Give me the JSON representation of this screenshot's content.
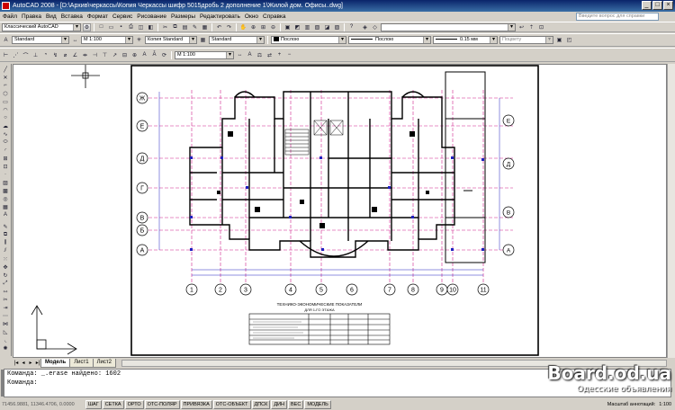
{
  "window": {
    "title": "AutoCAD 2008 - [D:\\Архив\\черкассы\\Копия Черкассы шифр  5015дробь 2 дополнение 1\\Жилой дом. Офисы..dwg]"
  },
  "menu": {
    "items": [
      "Файл",
      "Правка",
      "Вид",
      "Вставка",
      "Формат",
      "Сервис",
      "Рисование",
      "Размеры",
      "Редактировать",
      "Окно",
      "Справка"
    ],
    "help_placeholder": "Введите вопрос для справки"
  },
  "toolbars": {
    "workspace": "Классический AutoCAD",
    "text_style": "Standard",
    "dim_scale": "М 1:100",
    "dim_style": "Копия Standard",
    "table_style": "Standard",
    "color": "Послою",
    "linetype": "Послою",
    "lineweight": "0.15 мм",
    "plot_style": "Поцвету",
    "annotation_scale": "М 1:100"
  },
  "drawing": {
    "title_block": "ТЕХНИКО-ЭКОНОМИЧЕСКИЕ ПОКАЗАТЕЛИ",
    "title_block_sub": "ДЛЯ 1-ГО ЭТАЖА",
    "axis_numbers": [
      "1",
      "2",
      "3",
      "4",
      "5",
      "6",
      "7",
      "8",
      "9",
      "10",
      "11"
    ],
    "axis_letters": [
      "Ж",
      "Е",
      "Д",
      "Г",
      "В",
      "Б",
      "А"
    ],
    "axis_letters_right": [
      "Е",
      "Д",
      "В",
      "А"
    ]
  },
  "tabs": {
    "items": [
      "Модель",
      "Лист1",
      "Лист2"
    ],
    "active": 0
  },
  "command": {
    "line1": "Команда: _.erase найдено: 1602",
    "line2": "Команда:"
  },
  "status": {
    "coords": "71456.9881, 11346.4706, 0.0000",
    "toggles": [
      "ШАГ",
      "СЕТКА",
      "ОРТО",
      "ОТС-ПОЛЯР",
      "ПРИВЯЗКА",
      "ОТС-ОБЪЕКТ",
      "ДПСК",
      "ДИН",
      "ВЕС",
      "МОДЕЛЬ"
    ],
    "annotation_scale_label": "Масштаб аннотаций:",
    "annotation_scale_value": "1:100"
  },
  "watermark": {
    "main": "Board.od.ua",
    "sub": "Одесские объявления"
  },
  "colors": {
    "title_bar": "#0a246a",
    "drawing_lines": "#000000",
    "grid_lines": "#d0208c",
    "dimension_lines": "#2020c0"
  }
}
